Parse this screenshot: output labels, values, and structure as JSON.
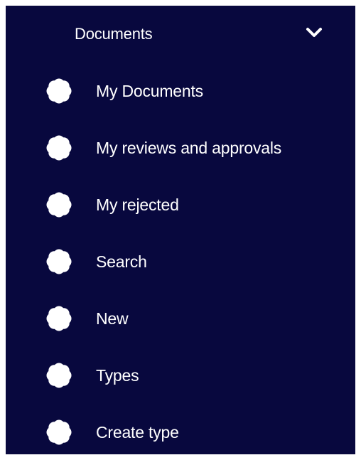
{
  "sidebar": {
    "section": {
      "title": "Documents",
      "toggle_icon": "chevron-down-icon",
      "expanded": true
    },
    "bullet_icon": "flower-bullet-icon",
    "colors": {
      "background": "#08083e",
      "text": "#ffffff",
      "icon": "#ffffff"
    },
    "items": [
      {
        "label": "My Documents"
      },
      {
        "label": "My reviews and approvals"
      },
      {
        "label": "My rejected"
      },
      {
        "label": "Search"
      },
      {
        "label": "New"
      },
      {
        "label": "Types"
      },
      {
        "label": "Create type"
      }
    ]
  }
}
